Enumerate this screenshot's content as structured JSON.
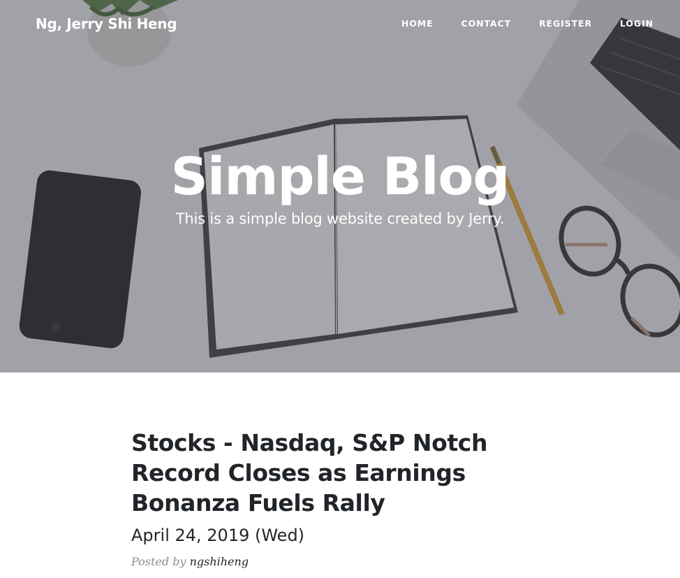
{
  "navbar": {
    "brand": "Ng, Jerry Shi Heng",
    "links": [
      "HOME",
      "CONTACT",
      "REGISTER",
      "LOGIN"
    ]
  },
  "header": {
    "title": "Simple Blog",
    "subheading": "This is a simple blog website created by Jerry."
  },
  "post": {
    "title": "Stocks - Nasdaq, S&P Notch Record Closes as Earnings Bonanza Fuels Rally",
    "subtitle": "April 24, 2019 (Wed)",
    "meta_prefix": "Posted by",
    "author": "ngshiheng"
  },
  "colors": {
    "text_dark": "#212529",
    "meta_gray": "#868e96",
    "overlay": "#464852"
  }
}
